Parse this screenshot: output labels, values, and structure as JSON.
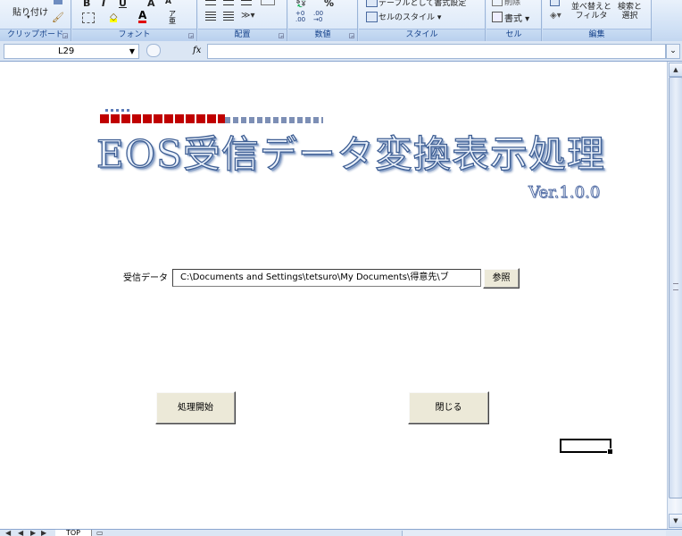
{
  "ribbon": {
    "clipboard": {
      "paste_label": "貼り付け",
      "group_label": "クリップボード"
    },
    "font": {
      "bold": "B",
      "italic": "I",
      "underline": "U",
      "font_color": "A",
      "group_label": "フォント"
    },
    "alignment": {
      "group_label": "配置"
    },
    "number": {
      "percent": "%",
      "group_label": "数値"
    },
    "styles": {
      "table_format": "テーブルとして書式設定",
      "cell_styles": "セルのスタイル",
      "group_label": "スタイル"
    },
    "cells": {
      "delete_label": "削除",
      "format_label": "書式",
      "group_label": "セル"
    },
    "editing": {
      "sort_filter_label": "並べ替えと\nフィルタ",
      "find_select_label": "検索と\n選択",
      "group_label": "編集"
    }
  },
  "formula_bar": {
    "name_box": "L29",
    "fx_label": "fx"
  },
  "sheet": {
    "title": "EOS受信データ変換表示処理",
    "version": "Ver.1.0.0",
    "recv_label": "受信データ",
    "path_value": "C:\\Documents and Settings\\tetsuro\\My Documents\\得意先\\ブ",
    "browse_button": "参照",
    "start_button": "処理開始",
    "close_button": "閉じる"
  },
  "tabs": {
    "active_tab": "TOP"
  },
  "colors": {
    "ribbon_bg": "#cfe0f5",
    "title_outline": "#3f5f94",
    "accent_red": "#c00000"
  }
}
